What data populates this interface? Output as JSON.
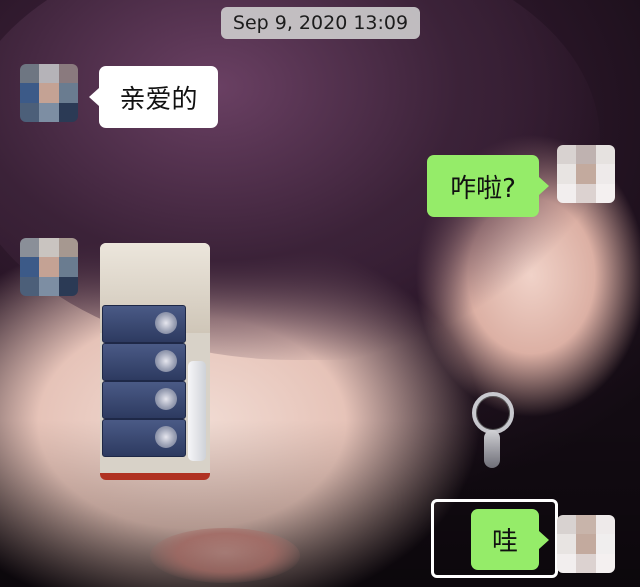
{
  "chat": {
    "timestamp": "Sep 9, 2020 13:09",
    "messages": [
      {
        "side": "left",
        "type": "text",
        "text": "亲爱的"
      },
      {
        "side": "right",
        "type": "text",
        "text": "咋啦?"
      },
      {
        "side": "left",
        "type": "image"
      },
      {
        "side": "right",
        "type": "text",
        "text": "哇",
        "highlighted": true
      }
    ]
  },
  "colors": {
    "incoming_bubble": "#ffffff",
    "outgoing_bubble": "#95ec69",
    "timestamp_bg": "#d2d2d2"
  }
}
